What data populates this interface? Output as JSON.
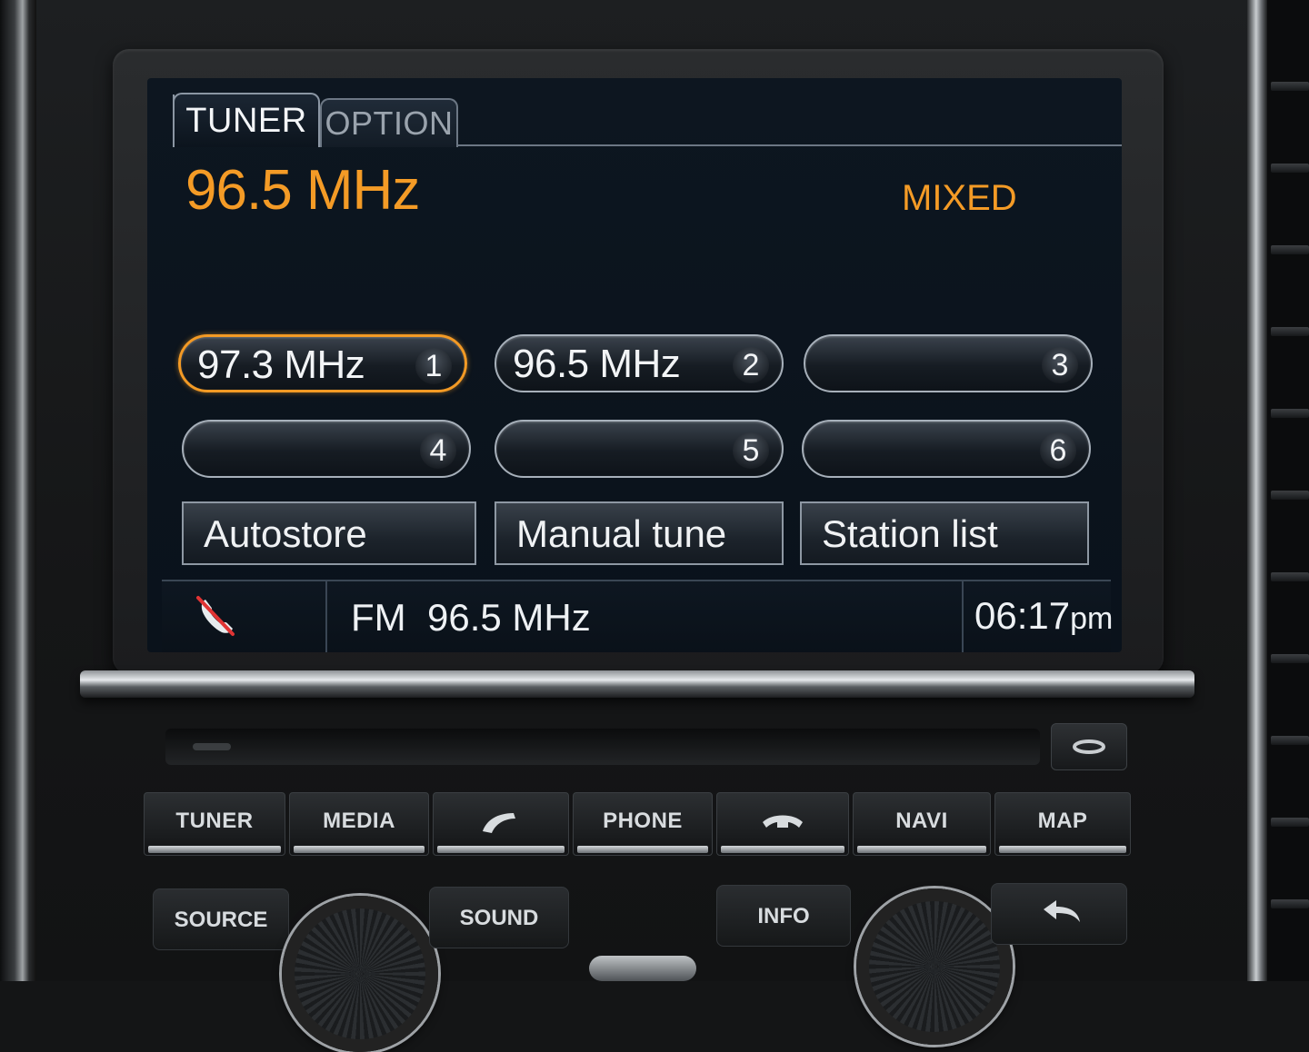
{
  "screen": {
    "tabs": [
      {
        "label": "TUNER",
        "active": true
      },
      {
        "label": "OPTION",
        "active": false
      }
    ],
    "current_frequency": "96.5 MHz",
    "program_type": "MIXED",
    "presets": [
      {
        "label": "97.3 MHz",
        "number": "1",
        "selected": true
      },
      {
        "label": "96.5 MHz",
        "number": "2",
        "selected": false
      },
      {
        "label": "",
        "number": "3",
        "selected": false
      },
      {
        "label": "",
        "number": "4",
        "selected": false
      },
      {
        "label": "",
        "number": "5",
        "selected": false
      },
      {
        "label": "",
        "number": "6",
        "selected": false
      }
    ],
    "actions": {
      "autostore": "Autostore",
      "manual_tune": "Manual tune",
      "station_list": "Station list"
    },
    "status": {
      "phone_icon": "phone-muted-icon",
      "band": "FM",
      "frequency": "96.5 MHz",
      "time": "06:17",
      "ampm": "pm"
    }
  },
  "hardware": {
    "row1": [
      {
        "label": "TUNER"
      },
      {
        "label": "MEDIA"
      },
      {
        "label": "",
        "icon": "call-accept-icon"
      },
      {
        "label": "PHONE"
      },
      {
        "label": "",
        "icon": "call-end-icon"
      },
      {
        "label": "NAVI"
      },
      {
        "label": "MAP"
      }
    ],
    "row2": {
      "source": "SOURCE",
      "sound": "SOUND",
      "info": "INFO",
      "back_icon": "back-arrow-icon"
    },
    "eject_icon": "eject-icon"
  },
  "colors": {
    "accent_orange": "#f49b26",
    "screen_bg": "#0a121b",
    "text_white": "#f2f4f6"
  }
}
